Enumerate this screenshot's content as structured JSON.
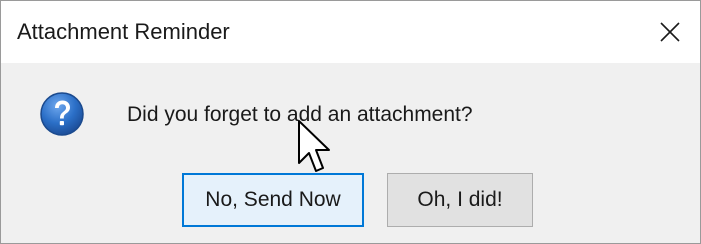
{
  "window": {
    "title": "Attachment Reminder",
    "close_symbol": "✕"
  },
  "dialog": {
    "icon": "question-icon",
    "message": "Did you forget to add an attachment?",
    "buttons": {
      "send_now": "No, Send Now",
      "did_attach": "Oh, I did!"
    }
  },
  "colors": {
    "accent": "#0078d7",
    "question_icon_blue": "#2b6fc7",
    "dialog_bg": "#f0f0f0"
  }
}
